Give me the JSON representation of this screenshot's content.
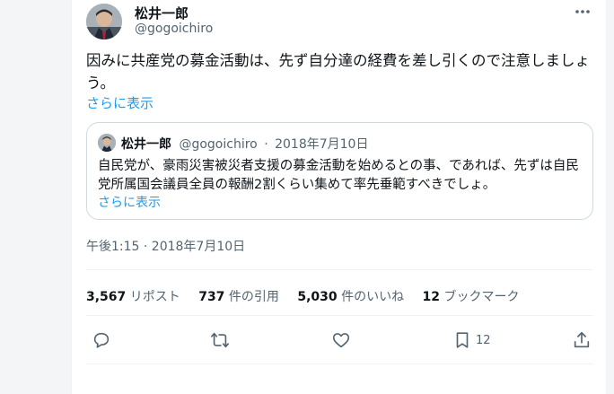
{
  "tweet": {
    "display_name": "松井一郎",
    "handle": "@gogoichiro",
    "text": "因みに共産党の募金活動は、先ず自分達の経費を差し引くので注意しましょう。",
    "show_more": "さらに表示",
    "timestamp": "午後1:15 · 2018年7月10日"
  },
  "quote": {
    "display_name": "松井一郎",
    "handle": "@gogoichiro",
    "separator": "·",
    "date": "2018年7月10日",
    "text": "自民党が、豪雨災害被災者支援の募金活動を始めるとの事、であれば、先ずは自民党所属国会議員全員の報酬2割くらい集めて率先垂範すべきでしょ。",
    "show_more": "さらに表示"
  },
  "stats": {
    "retweets_count": "3,567",
    "retweets_label": "リポスト",
    "quotes_count": "737",
    "quotes_label": "件の引用",
    "likes_count": "5,030",
    "likes_label": "件のいいね",
    "bookmarks_count": "12",
    "bookmarks_label": "ブックマーク"
  },
  "actions": {
    "reply_icon": "reply-icon",
    "retweet_icon": "retweet-icon",
    "like_icon": "heart-icon",
    "bookmark_icon": "bookmark-icon",
    "bookmark_count": "12",
    "share_icon": "share-icon"
  },
  "colors": {
    "link": "#1d9bf0",
    "text": "#0f1419",
    "secondary": "#536471",
    "border": "#cfd9de"
  }
}
